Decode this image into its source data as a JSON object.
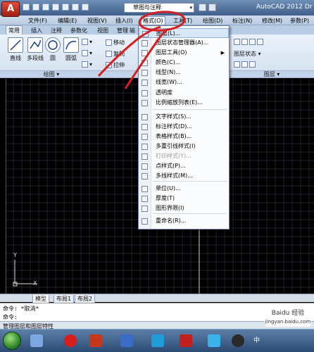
{
  "window": {
    "app_button": "A",
    "workspace": "草图与注释",
    "title": "AutoCAD 2012   Dr"
  },
  "menubar": {
    "items": [
      "文件(F)",
      "编辑(E)",
      "视图(V)",
      "插入(I)",
      "格式(O)",
      "工具(T)",
      "绘图(D)",
      "标注(N)",
      "修改(M)",
      "参数(P)"
    ]
  },
  "ribbon_tabs": {
    "items": [
      "常用",
      "插入",
      "注释",
      "参数化",
      "视图",
      "管理",
      "输"
    ]
  },
  "ribbon": {
    "tools": [
      "直线",
      "多段线",
      "圆",
      "圆弧"
    ],
    "small_tools": [
      "移动",
      "复制",
      "拉伸"
    ],
    "panel_draw": "绘图 ▾",
    "panel_layer": "图层 ▾",
    "layer_state": "图层状态"
  },
  "format_menu": {
    "items": [
      {
        "label": "图层(L)...",
        "disabled": false,
        "submenu": false
      },
      {
        "label": "图层状态管理器(A)...",
        "disabled": false,
        "submenu": false
      },
      {
        "label": "图层工具(O)",
        "disabled": false,
        "submenu": true
      },
      {
        "label": "颜色(C)...",
        "disabled": false,
        "submenu": false
      },
      {
        "label": "线型(N)...",
        "disabled": false,
        "submenu": false
      },
      {
        "label": "线宽(W)...",
        "disabled": false,
        "submenu": false
      },
      {
        "label": "透明度",
        "disabled": false,
        "submenu": false
      },
      {
        "label": "比例缩放列表(E)...",
        "disabled": false,
        "submenu": false
      },
      {
        "label": "文字样式(S)...",
        "disabled": false,
        "submenu": false
      },
      {
        "label": "标注样式(D)...",
        "disabled": false,
        "submenu": false
      },
      {
        "label": "表格样式(B)...",
        "disabled": false,
        "submenu": false
      },
      {
        "label": "多重引线样式(I)",
        "disabled": false,
        "submenu": false
      },
      {
        "label": "打印样式(Y)...",
        "disabled": true,
        "submenu": false
      },
      {
        "label": "点样式(P)...",
        "disabled": false,
        "submenu": false
      },
      {
        "label": "多线样式(M)...",
        "disabled": false,
        "submenu": false
      },
      {
        "label": "单位(U)...",
        "disabled": false,
        "submenu": false
      },
      {
        "label": "厚度(T)",
        "disabled": false,
        "submenu": false
      },
      {
        "label": "图形界限(I)",
        "disabled": false,
        "submenu": false
      },
      {
        "label": "重命名(R)...",
        "disabled": false,
        "submenu": false
      }
    ]
  },
  "ucs": {
    "x": "X",
    "y": "Y"
  },
  "layout_tabs": [
    "模型",
    "布局1",
    "布局2"
  ],
  "command": {
    "line1": "命令: *取消*",
    "line2": "命令:"
  },
  "status": {
    "text": "管理图层和图层特性"
  },
  "tray": {
    "ime": "中"
  },
  "watermark": {
    "line1": "Baidu 经验",
    "line2": "jingyan.baidu.com"
  },
  "colors": {
    "accent": "#d42020",
    "ribbon": "#d3e0f0",
    "menu_highlight": "#d9e6f6"
  }
}
